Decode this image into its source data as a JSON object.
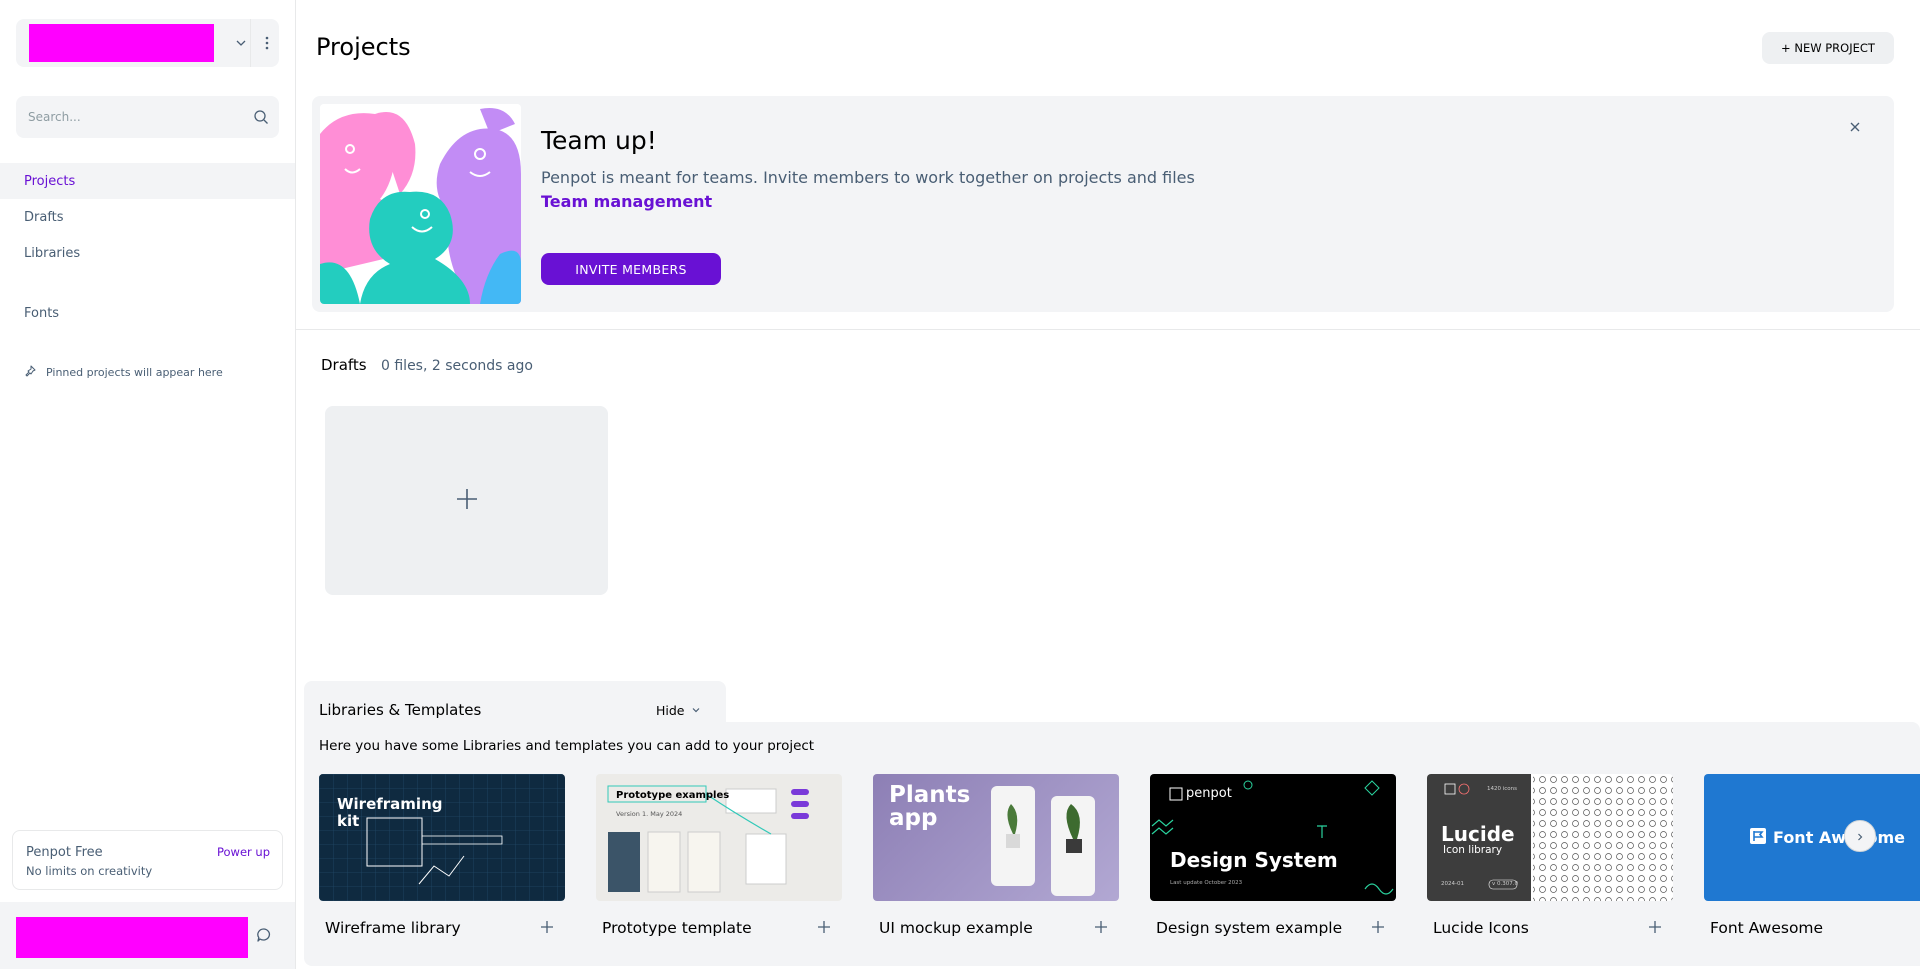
{
  "sidebar": {
    "search": {
      "placeholder": "Search..."
    },
    "nav": [
      {
        "label": "Projects",
        "active": true
      },
      {
        "label": "Drafts",
        "active": false
      },
      {
        "label": "Libraries",
        "active": false
      },
      {
        "label": "Fonts",
        "active": false
      }
    ],
    "pinned_text": "Pinned projects will appear here",
    "plan": {
      "title": "Penpot Free",
      "subtitle": "No limits on creativity",
      "upgrade_label": "Power up"
    },
    "icons": {
      "chevron": "chevron-down-icon",
      "more": "more-vertical-icon",
      "search": "search-icon",
      "pin": "pin-icon",
      "chat": "chat-icon"
    }
  },
  "header": {
    "title": "Projects",
    "new_project_label": "+ NEW PROJECT"
  },
  "banner": {
    "title": "Team up!",
    "text": "Penpot is meant for teams. Invite members to work together on projects and files",
    "link": "Team management",
    "button": "INVITE MEMBERS"
  },
  "drafts": {
    "title": "Drafts",
    "info": "0 files, 2 seconds ago"
  },
  "libraries": {
    "title": "Libraries & Templates",
    "hide_label": "Hide",
    "description": "Here you have some Libraries and templates you can add to your project",
    "cards": [
      {
        "name": "Wireframe library",
        "thumb_text": "Wireframing kit"
      },
      {
        "name": "Prototype template",
        "thumb_text": "Prototype examples",
        "thumb_sub": "Version 1. May 2024"
      },
      {
        "name": "UI mockup example",
        "thumb_text": "Plants app"
      },
      {
        "name": "Design system example",
        "thumb_text": "Design System",
        "thumb_brand": "penpot",
        "thumb_sub": "Last update October 2023"
      },
      {
        "name": "Lucide Icons",
        "thumb_text": "Lucide",
        "thumb_sub": "Icon library",
        "thumb_count": "1420 icons",
        "thumb_date": "2024-01",
        "thumb_version": "v 0.307.0"
      },
      {
        "name": "Font Awesome",
        "thumb_text": "Font Awesome"
      }
    ]
  },
  "colors": {
    "accent": "#6911d4",
    "redacted": "#ff00ff",
    "panel_bg": "#f3f4f6",
    "text_muted": "#495e74"
  }
}
